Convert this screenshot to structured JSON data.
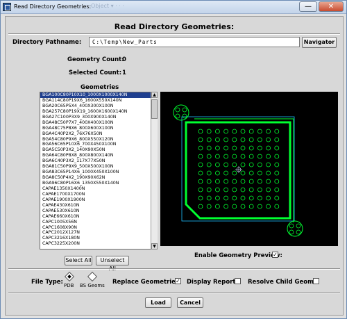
{
  "window": {
    "title": "Read Directory Geometries:",
    "bg_tabs": "Object  ▾   ·  ·  ·",
    "minimize": "—",
    "close": "✕"
  },
  "dialog": {
    "heading": "Read Directory Geometries:",
    "pathname_label": "Directory Pathname:",
    "pathname_value": "C:\\Temp\\New_Parts",
    "navigator_label": "Navigator",
    "geometry_count_label": "Geometry Count:",
    "geometry_count": "0",
    "selected_count_label": "Selected Count:",
    "selected_count": "1",
    "geometries_label": "Geometries",
    "select_all": "Select All",
    "unselect_all": "Unselect All",
    "enable_preview_label": "Enable Geometry Preview:",
    "enable_preview_checked": "✓",
    "file_type_label": "File Type:",
    "file_type_pdb": "PDB",
    "file_type_bs": "BS Geoms",
    "replace_label": "Replace Geometries:",
    "replace_checked": "✓",
    "display_report_label": "Display Report:",
    "resolve_child_label": "Resolve Child Geoms:",
    "load": "Load",
    "cancel": "Cancel"
  },
  "geometries": [
    "BGA100C80P10X10_1000X1000X140N",
    "BGA114C80P19X6_1600X550X140N",
    "BGA20C65P5X4_400X300X100N",
    "BGA257C80P19X19_1600X1600X140N",
    "BGA27C100P3X9_300X900X140N",
    "BGA48C50P7X7_400X400X100N",
    "BGA48C75P8X6_800X600X100N",
    "BGA4C40P2X2_76X76X50N",
    "BGA54C80P9X6_800X550X120N",
    "BGA56C65P10X6_700X450X100N",
    "BGA5C50P3X2_140X90X50N",
    "BGA64C80P8X8_800X800X140N",
    "BGA6C40P3X2_117X77X50N",
    "BGA81C50P9X9_500X500X100N",
    "BGA83C65P14X6_1000X450X100N",
    "BGA8C50P4X2_190X90X62N",
    "BGA96C80P16X6_1350X550X140N",
    "CAPAE1350X1400N",
    "CAPAE1700X1700N",
    "CAPAE1900X1900N",
    "CAPAE430X610N",
    "CAPAE530X610N",
    "CAPAE660X610N",
    "CAPC1005X56N",
    "CAPC1608X90N",
    "CAPC2012X127N",
    "CAPC3216X180N",
    "CAPC3225X200N"
  ],
  "colors": {
    "preview_bg": "#000000",
    "outline": "#00ff30",
    "body": "#20c0ff",
    "selection": "#1f3f8f"
  }
}
